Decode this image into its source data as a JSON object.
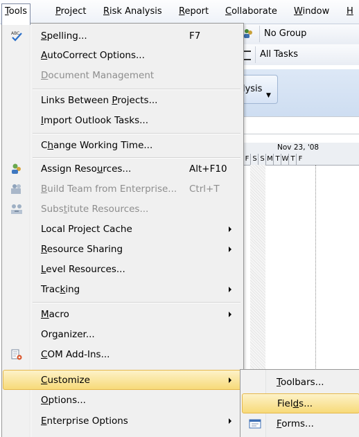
{
  "menubar": {
    "items": [
      {
        "label": "Tools",
        "key": "T",
        "rest": "ools"
      },
      {
        "label": "Project",
        "key": "P",
        "rest": "roject"
      },
      {
        "label": "Risk Analysis",
        "key": "R",
        "rest": "isk Analysis"
      },
      {
        "label": "Report",
        "key": "R",
        "rest": "eport"
      },
      {
        "label": "Collaborate",
        "key": "C",
        "rest": "ollaborate"
      },
      {
        "label": "Window",
        "key": "W",
        "rest": "indow"
      },
      {
        "label": "H",
        "key": "H",
        "rest": ""
      }
    ]
  },
  "background": {
    "group_combo": "No Group",
    "filter_combo": "All Tasks",
    "ribbon_partial": "alysis",
    "gantt_week": "Nov 23, '08",
    "gantt_days": [
      "F",
      "S",
      "S",
      "M",
      "T",
      "W",
      "T",
      "F"
    ]
  },
  "tools_menu": {
    "items": [
      {
        "pre": "",
        "key": "S",
        "post": "pelling...",
        "shortcut": "F7",
        "icon": "spelling-icon"
      },
      {
        "pre": "",
        "key": "A",
        "post": "utoCorrect Options..."
      },
      {
        "pre": "",
        "key": "D",
        "post": "ocument Management",
        "disabled": true
      },
      {
        "pre": "Links Between ",
        "key": "P",
        "post": "rojects..."
      },
      {
        "pre": "",
        "key": "I",
        "post": "mport Outlook Tasks..."
      },
      {
        "pre": "C",
        "key": "h",
        "post": "ange Working Time..."
      },
      {
        "pre": "Assign Reso",
        "key": "u",
        "post": "rces...",
        "shortcut": "Alt+F10",
        "icon": "assign-resources-icon"
      },
      {
        "pre": "",
        "key": "B",
        "post": "uild Team from Enterprise...",
        "shortcut": "Ctrl+T",
        "disabled": true,
        "icon": "build-team-icon"
      },
      {
        "pre": "Subs",
        "key": "t",
        "post": "itute Resources...",
        "disabled": true,
        "icon": "substitute-resources-icon"
      },
      {
        "pre": "Local Project Cache",
        "key": "",
        "post": "",
        "submenu": true
      },
      {
        "pre": "",
        "key": "R",
        "post": "esource Sharing",
        "submenu": true
      },
      {
        "pre": "",
        "key": "L",
        "post": "evel Resources..."
      },
      {
        "pre": "Trac",
        "key": "k",
        "post": "ing",
        "submenu": true
      },
      {
        "pre": "",
        "key": "M",
        "post": "acro",
        "submenu": true
      },
      {
        "pre": "Or",
        "key": "g",
        "post": "anizer..."
      },
      {
        "pre": "",
        "key": "C",
        "post": "OM Add-Ins...",
        "icon": "com-addins-icon"
      },
      {
        "pre": "",
        "key": "C",
        "post": "ustomize",
        "submenu": true,
        "highlighted": true
      },
      {
        "pre": "",
        "key": "O",
        "post": "ptions..."
      },
      {
        "pre": "",
        "key": "E",
        "post": "nterprise Options",
        "submenu": true
      }
    ]
  },
  "customize_submenu": {
    "items": [
      {
        "pre": "",
        "key": "T",
        "post": "oolbars..."
      },
      {
        "pre": "Fiel",
        "key": "d",
        "post": "s...",
        "highlighted": true
      },
      {
        "pre": "",
        "key": "F",
        "post": "orms...",
        "icon": "forms-icon"
      }
    ]
  }
}
